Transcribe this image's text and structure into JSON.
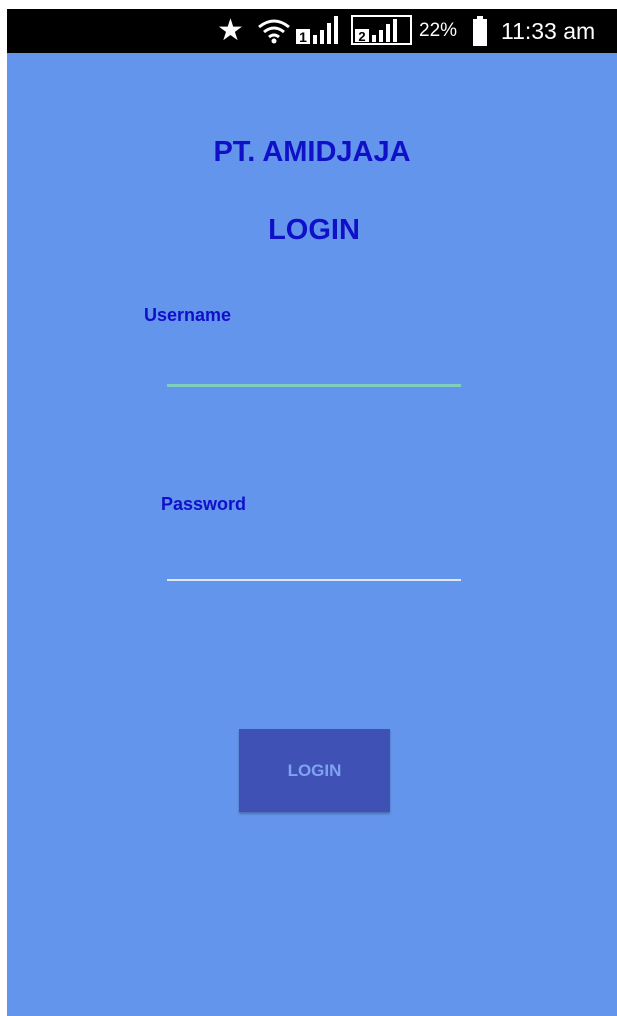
{
  "status_bar": {
    "star_icon": "star-icon",
    "wifi_icon": "wifi-icon",
    "sim1_label": "1",
    "sim2_label": "2",
    "battery_percent": "22%",
    "time": "11:33 am"
  },
  "login": {
    "company_name": "PT. AMIDJAJA",
    "heading": "LOGIN",
    "username_label": "Username",
    "username_value": "",
    "password_label": "Password",
    "password_value": "",
    "button_label": "LOGIN"
  },
  "colors": {
    "background": "#6495ed",
    "title_text": "#1010c8",
    "button_bg": "#3f51b5",
    "button_text": "#7fa3f2",
    "focused_underline": "#7fcfbf"
  }
}
